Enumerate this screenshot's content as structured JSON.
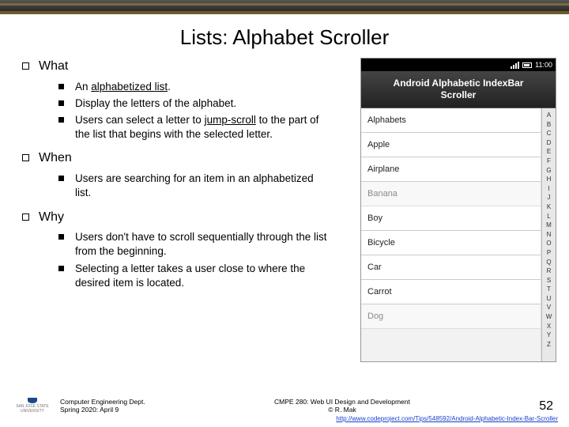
{
  "title": "Lists: Alphabet Scroller",
  "sections": {
    "what": {
      "heading": "What",
      "items": [
        {
          "pre": "An ",
          "u": "alphabetized list",
          "post": "."
        },
        {
          "text": "Display the letters of the alphabet."
        },
        {
          "pre": "Users can select a letter to ",
          "u": "jump-scroll",
          "post": " to the part of the list that begins with the selected letter."
        }
      ]
    },
    "when": {
      "heading": "When",
      "items": [
        {
          "text": "Users are searching for an item in an alphabetized list."
        }
      ]
    },
    "why": {
      "heading": "Why",
      "items": [
        {
          "text": "Users don't have to scroll sequentially through the list from the beginning."
        },
        {
          "text": "Selecting a letter takes a user close to where the desired item is located."
        }
      ]
    }
  },
  "screenshot": {
    "status_time": "11:00",
    "app_title_l1": "Android Alphabetic IndexBar",
    "app_title_l2": "Scroller",
    "list": [
      "Alphabets",
      "Apple",
      "Airplane",
      "Banana",
      "Boy",
      "Bicycle",
      "Car",
      "Carrot",
      "Dog"
    ],
    "index": [
      "A",
      "B",
      "C",
      "D",
      "E",
      "F",
      "G",
      "H",
      "I",
      "J",
      "K",
      "L",
      "M",
      "N",
      "O",
      "P",
      "Q",
      "R",
      "S",
      "T",
      "U",
      "V",
      "W",
      "X",
      "Y",
      "Z"
    ]
  },
  "footer": {
    "dept": "Computer Engineering Dept.",
    "date": "Spring 2020: April 9",
    "course": "CMPE 280: Web UI Design and Development",
    "author": "© R. Mak",
    "page": "52",
    "logo_text": "SAN JOSÉ STATE UNIVERSITY",
    "link": "http://www.codeproject.com/Tips/548592/Android-Alphabetic-Index-Bar-Scroller"
  }
}
